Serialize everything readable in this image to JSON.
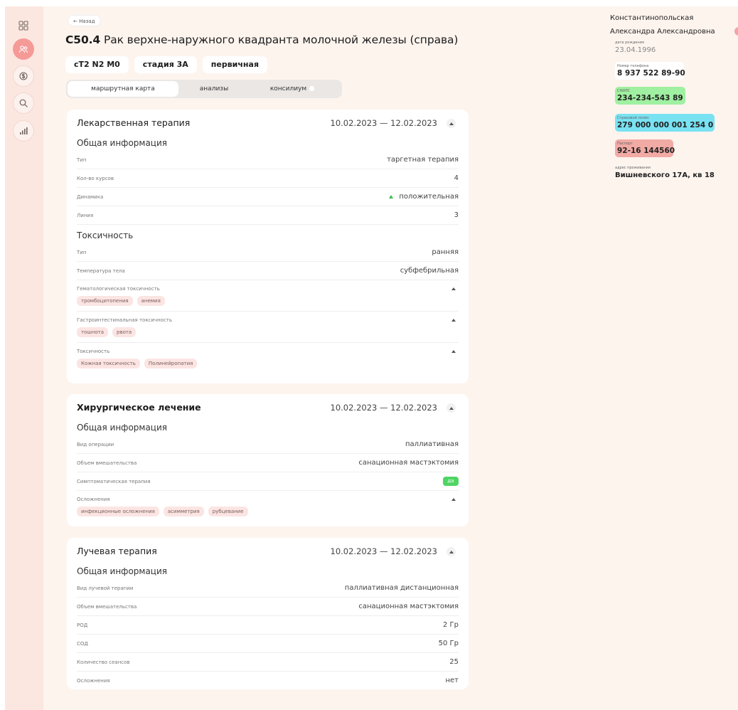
{
  "nav": {
    "back_label": "← Назад"
  },
  "diagnosis": {
    "code": "C50.4",
    "title": "Рак верхне-наружного квадранта молочной железы (справа)"
  },
  "tags": [
    "cT2 N2 M0",
    "стадия 3А",
    "первичная"
  ],
  "tabs": [
    {
      "label": "маршрутная карта",
      "active": true
    },
    {
      "label": "анализы",
      "active": false
    },
    {
      "label": "консилиум",
      "active": false
    }
  ],
  "cards": {
    "drug": {
      "title": "Лекарственная терапия",
      "dates": "10.02.2023 — 12.02.2023",
      "general_title": "Общая информация",
      "rows": [
        {
          "label": "Тип",
          "value": "таргетная терапия"
        },
        {
          "label": "Кол-во курсов",
          "value": "4"
        },
        {
          "label": "Динамика",
          "value": "положительная"
        },
        {
          "label": "Линия",
          "value": "3"
        }
      ],
      "toxicity_title": "Токсичность",
      "toxicity_rows": [
        {
          "label": "Тип",
          "value": "ранняя"
        },
        {
          "label": "Температура тела",
          "value": "субфебрильная"
        }
      ],
      "groups": [
        {
          "label": "Гематологическая токсичность",
          "chips": [
            "тромбоцитопения",
            "анемия"
          ]
        },
        {
          "label": "Гастроинтестинальная токсичность",
          "chips": [
            "тошнота",
            "рвота"
          ]
        },
        {
          "label": "Токсичность",
          "chips": [
            "Кожная токсичность",
            "Полинейропатия"
          ]
        }
      ]
    },
    "surgery": {
      "title": "Хирургическое лечение",
      "dates": "10.02.2023 — 12.02.2023",
      "general_title": "Общая информация",
      "rows": [
        {
          "label": "Вид операции",
          "value": "паллиативная"
        },
        {
          "label": "Объем вмешательства",
          "value": "санационная мастэктомия"
        },
        {
          "label": "Симптоматическая терапия",
          "value": "да"
        }
      ],
      "complications": {
        "label": "Осложнения",
        "chips": [
          "инфекционные осложнения",
          "асимметрия",
          "рубцевание"
        ]
      }
    },
    "radiation": {
      "title": "Лучевая терапия",
      "dates": "10.02.2023 — 12.02.2023",
      "general_title": "Общая информация",
      "rows": [
        {
          "label": "Вид лучевой терапии",
          "value": "паллиативная дистанционная"
        },
        {
          "label": "Объем вмешательства",
          "value": "санационная мастэктомия"
        },
        {
          "label": "РОД",
          "value": "2 Гр"
        },
        {
          "label": "СОД",
          "value": "50 Гр"
        },
        {
          "label": "Количество сеансов",
          "value": "25"
        },
        {
          "label": "Осложнения",
          "value": "нет"
        }
      ]
    }
  },
  "patient": {
    "last_name": "Константинопольская",
    "first_names": "Александра Александровна",
    "birth_label": "дата рождения",
    "birth_date": "23.04.1996",
    "phone_label": "Номер телефона",
    "phone": "8 937 522 89-90",
    "snils_label": "СНИЛС",
    "snils": "234-234-543 89",
    "policy_label": "Страховой полис",
    "policy": "279 000 000 001 254 0",
    "passport_label": "Паспорт",
    "passport": "92-16 144560",
    "address_label": "адрес проживания",
    "address": "Вишневского 17А, кв 18"
  },
  "colors": {
    "page_bg": "#fdf4ee",
    "rail_bg": "#fbe7e0",
    "rail_active": "#f59a97",
    "snils_bg": "#9ff0a0",
    "policy_bg": "#79e2f2",
    "passport_bg": "#f2aaa5",
    "chip_bg": "#fbe5e3",
    "yes_badge": "#4ed564"
  }
}
